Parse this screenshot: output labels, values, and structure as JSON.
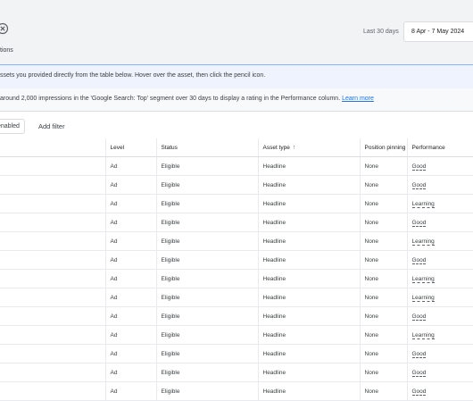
{
  "header": {
    "sub_label": "tions",
    "range_label": "Last 30 days",
    "date_range": "8 Apr - 7 May 2024"
  },
  "banners": {
    "instruction": "ssets you provided directly from the table below. Hover over the asset, then click the pencil icon.",
    "impressions_notice": "around 2,000 impressions in the 'Google Search: Top' segment over 30 days to display a rating in the Performance column.",
    "learn_more": "Learn more"
  },
  "filters": {
    "chip_label": "enabled",
    "add_filter": "Add filter"
  },
  "table": {
    "columns": [
      "Level",
      "Status",
      "Asset type",
      "Position pinning",
      "Performance"
    ],
    "sort_icon": "arrow-up-icon",
    "rows": [
      {
        "level": "Ad",
        "status": "Eligible",
        "asset_type": "Headline",
        "pinning": "None",
        "performance": "Good"
      },
      {
        "level": "Ad",
        "status": "Eligible",
        "asset_type": "Headline",
        "pinning": "None",
        "performance": "Good"
      },
      {
        "level": "Ad",
        "status": "Eligible",
        "asset_type": "Headline",
        "pinning": "None",
        "performance": "Learning"
      },
      {
        "level": "Ad",
        "status": "Eligible",
        "asset_type": "Headline",
        "pinning": "None",
        "performance": "Good"
      },
      {
        "level": "Ad",
        "status": "Eligible",
        "asset_type": "Headline",
        "pinning": "None",
        "performance": "Learning"
      },
      {
        "level": "Ad",
        "status": "Eligible",
        "asset_type": "Headline",
        "pinning": "None",
        "performance": "Good"
      },
      {
        "level": "Ad",
        "status": "Eligible",
        "asset_type": "Headline",
        "pinning": "None",
        "performance": "Learning"
      },
      {
        "level": "Ad",
        "status": "Eligible",
        "asset_type": "Headline",
        "pinning": "None",
        "performance": "Learning"
      },
      {
        "level": "Ad",
        "status": "Eligible",
        "asset_type": "Headline",
        "pinning": "None",
        "performance": "Good"
      },
      {
        "level": "Ad",
        "status": "Eligible",
        "asset_type": "Headline",
        "pinning": "None",
        "performance": "Learning"
      },
      {
        "level": "Ad",
        "status": "Eligible",
        "asset_type": "Headline",
        "pinning": "None",
        "performance": "Good"
      },
      {
        "level": "Ad",
        "status": "Eligible",
        "asset_type": "Headline",
        "pinning": "None",
        "performance": "Good"
      },
      {
        "level": "Ad",
        "status": "Eligible",
        "asset_type": "Headline",
        "pinning": "None",
        "performance": "Good"
      }
    ]
  },
  "colors": {
    "accent": "#1a73e8",
    "header_bg": "#f1f3f4",
    "banner_bg": "#eef3fd"
  }
}
